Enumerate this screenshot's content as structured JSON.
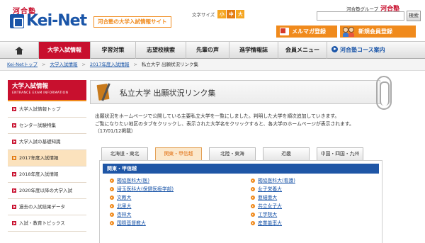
{
  "header": {
    "kawai_logo": "河合塾",
    "keinet_logo": "Kei-Net",
    "tagline": "河合塾の大学入試情報サイト",
    "font_size_label": "文字サイズ",
    "font_sizes": [
      "小",
      "中",
      "大"
    ],
    "group_label": "河合塾グループ",
    "group_logo": "河合塾",
    "search_placeholder": "",
    "search_button": "検索",
    "mailmag_button": "メルマガ登録",
    "member_button": "新規会員登録"
  },
  "gnav": {
    "items": [
      "大学入試情報",
      "学習対策",
      "志望校検索",
      "先輩の声",
      "進学情報誌",
      "会員メニュー"
    ],
    "course_link": "河合塾コース案内"
  },
  "breadcrumb": {
    "items": [
      "Kei-Netトップ",
      "大学入試情報",
      "2017年度入試情報"
    ],
    "current": "私立大学 出願状況リンク集"
  },
  "sidebar": {
    "title": "大学入試情報",
    "subtitle": "ENTRANCE EXAM INFORMATION",
    "items": [
      "大学入試情報トップ",
      "センター試験特集",
      "大学入試の基礎知識",
      "2017年度入試情報",
      "2018年度入試情報",
      "2020年度以降の大学入試",
      "過去の入試結果データ",
      "入試・教育トピックス"
    ]
  },
  "main": {
    "title": "私立大学 出願状況リンク集",
    "intro": [
      "出願状況をホームページで公開している主要私立大学を一覧にしました。判明した大学を順次追加していきます。",
      "ご覧になりたい地区のタブをクリックし、表示された大学名をクリックすると、各大学のホームページが表示されます。",
      "（17/01/12掲載）"
    ],
    "tabs": [
      "北海道・東北",
      "関東・甲信越",
      "北陸・東海",
      "近畿",
      "中国・四国・九州"
    ],
    "region_heading": "関東・甲信越",
    "universities_left": [
      "獨協医科大(医)",
      "埼玉医科大(保健医療学部)",
      "文教大",
      "北里大",
      "杏林大",
      "国際基督教大"
    ],
    "universities_right": [
      "獨協医科大(看護)",
      "女子栄養大",
      "亜細亜大",
      "共立女子大",
      "工学院大",
      "産業能率大"
    ]
  }
}
